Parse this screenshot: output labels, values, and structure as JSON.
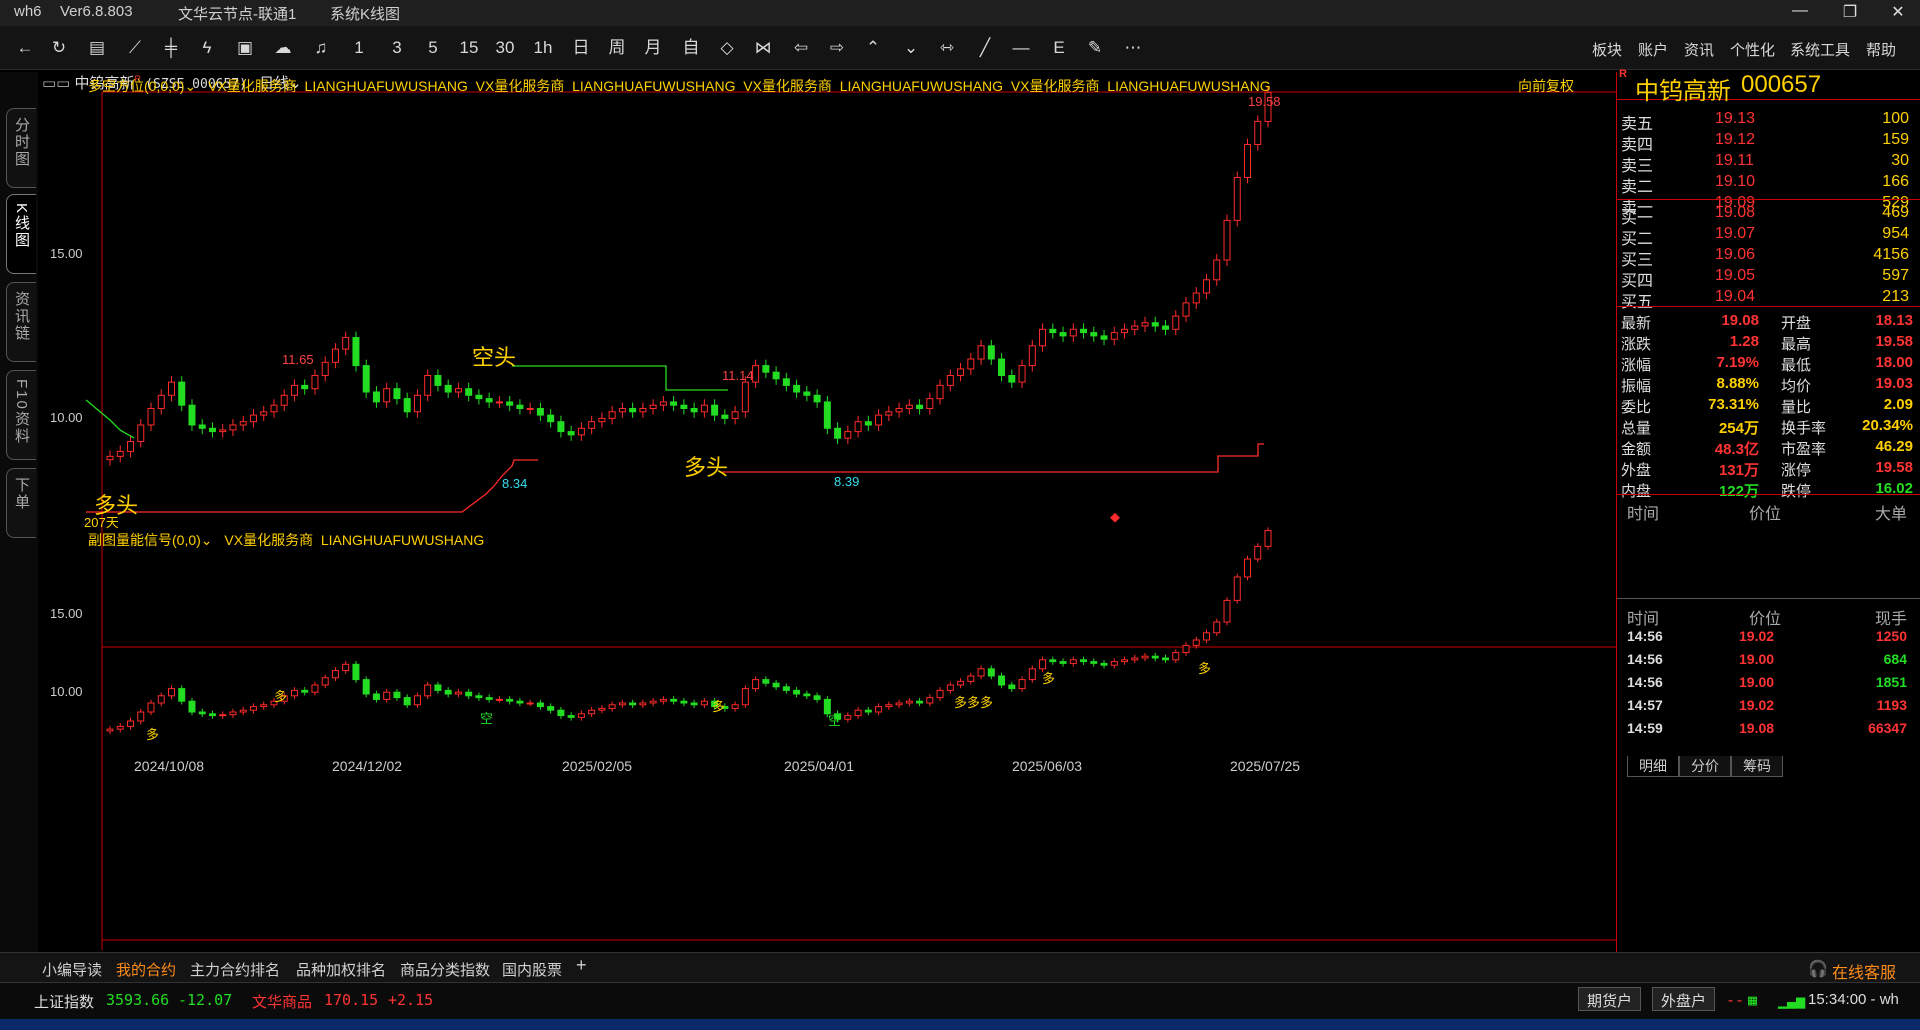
{
  "titlebar": {
    "app": "wh6",
    "version": "Ver6.8.803",
    "node": "文华云节点-联通1",
    "window": "系统K线图"
  },
  "toolbar": {
    "periods": [
      "1",
      "3",
      "5",
      "15",
      "30",
      "1h",
      "日",
      "周",
      "月",
      "自"
    ],
    "menu": [
      "板块",
      "账户",
      "资讯",
      "个性化",
      "系统工具",
      "帮助"
    ]
  },
  "left_tabs": [
    "分时图",
    "K线图",
    "资讯链",
    "F10资料",
    "下单"
  ],
  "header": {
    "stock_name": "中钨高新",
    "stock_sup": "R",
    "code_full": "(SZSE 000657)",
    "period": "日线"
  },
  "main_indicator": {
    "name": "多空方位(0,0,0)",
    "text": "VX量化服务商  LIANGHUAFUWUSHANG  VX量化服务商  LIANGHUAFUWUSHANG  VX量化服务商  LIANGHUAFUWUSHANG  VX量化服务商  LIANGHUAFUWUSHANG",
    "adjust": "向前复权"
  },
  "sub_indicator": {
    "name": "副图量能信号(0,0)",
    "text": "VX量化服务商  LIANGHUAFUWUSHANG"
  },
  "annotations": {
    "kongtou": "空头",
    "duotou1": "多头",
    "duotou2": "多头",
    "days": "207天",
    "high1": "11.65",
    "high2": "11.14",
    "low1": "8.34",
    "low2": "8.39",
    "top": "19.58",
    "sig_duo": "多",
    "sig_kong": "空",
    "sig_duo3": "多多多"
  },
  "chart_data": {
    "type": "candlestick",
    "y_ticks_main": [
      "15.00",
      "10.00"
    ],
    "y_ticks_sub": [
      "15.00",
      "10.00"
    ],
    "x_ticks": [
      "2024/10/08",
      "2024/12/02",
      "2025/02/05",
      "2025/04/01",
      "2025/06/03",
      "2025/07/25"
    ],
    "close": [
      8.05,
      8.2,
      8.5,
      9.0,
      9.5,
      9.9,
      10.3,
      9.6,
      9.0,
      8.9,
      8.8,
      8.85,
      9.0,
      9.1,
      9.3,
      9.4,
      9.6,
      9.9,
      10.2,
      10.1,
      10.5,
      10.9,
      11.3,
      11.65,
      10.8,
      10.0,
      9.7,
      10.1,
      9.8,
      9.4,
      9.9,
      10.5,
      10.2,
      10.0,
      10.1,
      9.9,
      9.8,
      9.7,
      9.7,
      9.6,
      9.5,
      9.5,
      9.3,
      9.1,
      8.8,
      8.7,
      8.9,
      9.1,
      9.2,
      9.4,
      9.5,
      9.4,
      9.5,
      9.6,
      9.7,
      9.6,
      9.5,
      9.4,
      9.6,
      9.3,
      9.2,
      9.4,
      10.3,
      10.8,
      10.6,
      10.4,
      10.2,
      10.0,
      9.9,
      9.7,
      8.9,
      8.6,
      8.8,
      9.1,
      9.0,
      9.3,
      9.4,
      9.5,
      9.6,
      9.5,
      9.8,
      10.2,
      10.5,
      10.7,
      11.0,
      11.4,
      11.0,
      10.5,
      10.3,
      10.8,
      11.4,
      11.9,
      11.8,
      11.7,
      11.9,
      11.8,
      11.7,
      11.6,
      11.8,
      11.9,
      12.0,
      12.1,
      12.0,
      11.9,
      12.3,
      12.7,
      13.0,
      13.4,
      14.0,
      15.2,
      16.5,
      17.5,
      18.2,
      19.08
    ],
    "series_names": [
      "K线"
    ]
  },
  "quote": {
    "stock_title": "中钨高新",
    "stock_code": "000657",
    "asks": [
      {
        "label": "卖五",
        "price": "19.13",
        "vol": "100"
      },
      {
        "label": "卖四",
        "price": "19.12",
        "vol": "159"
      },
      {
        "label": "卖三",
        "price": "19.11",
        "vol": "30"
      },
      {
        "label": "卖二",
        "price": "19.10",
        "vol": "166"
      },
      {
        "label": "卖一",
        "price": "19.09",
        "vol": "529"
      }
    ],
    "bids": [
      {
        "label": "买一",
        "price": "19.08",
        "vol": "469"
      },
      {
        "label": "买二",
        "price": "19.07",
        "vol": "954"
      },
      {
        "label": "买三",
        "price": "19.06",
        "vol": "4156"
      },
      {
        "label": "买四",
        "price": "19.05",
        "vol": "597"
      },
      {
        "label": "买五",
        "price": "19.04",
        "vol": "213"
      }
    ],
    "stats": [
      {
        "k1": "最新",
        "v1": "19.08",
        "c1": "#ff3333",
        "k2": "开盘",
        "v2": "18.13",
        "c2": "#ff3333"
      },
      {
        "k1": "涨跌",
        "v1": "1.28",
        "c1": "#ff3333",
        "k2": "最高",
        "v2": "19.58",
        "c2": "#ff3333"
      },
      {
        "k1": "涨幅",
        "v1": "7.19%",
        "c1": "#ff3333",
        "k2": "最低",
        "v2": "18.00",
        "c2": "#ff3333"
      },
      {
        "k1": "振幅",
        "v1": "8.88%",
        "c1": "#ffd000",
        "k2": "均价",
        "v2": "19.03",
        "c2": "#ff3333"
      },
      {
        "k1": "委比",
        "v1": "73.31%",
        "c1": "#ffd000",
        "k2": "量比",
        "v2": "2.09",
        "c2": "#ffd000"
      },
      {
        "k1": "总量",
        "v1": "254万",
        "c1": "#ffd000",
        "k2": "换手率",
        "v2": "20.34%",
        "c2": "#ffd000"
      },
      {
        "k1": "金额",
        "v1": "48.3亿",
        "c1": "#ff3333",
        "k2": "市盈率",
        "v2": "46.29",
        "c2": "#ffd000"
      },
      {
        "k1": "外盘",
        "v1": "131万",
        "c1": "#ff3333",
        "k2": "涨停",
        "v2": "19.58",
        "c2": "#ff3333"
      },
      {
        "k1": "内盘",
        "v1": "122万",
        "c1": "#22dd22",
        "k2": "跌停",
        "v2": "16.02",
        "c2": "#22dd22"
      }
    ],
    "big_header": {
      "t": "时间",
      "p": "价位",
      "v": "大单"
    },
    "ticks_header": {
      "t": "时间",
      "p": "价位",
      "v": "现手"
    },
    "ticks": [
      {
        "t": "14:56",
        "p": "19.02",
        "v": "1250",
        "vc": "#ff3333"
      },
      {
        "t": "14:56",
        "p": "19.00",
        "v": "684",
        "vc": "#22dd22"
      },
      {
        "t": "14:56",
        "p": "19.00",
        "v": "1851",
        "vc": "#22dd22"
      },
      {
        "t": "14:57",
        "p": "19.02",
        "v": "1193",
        "vc": "#ff3333"
      },
      {
        "t": "14:59",
        "p": "19.08",
        "v": "66347",
        "vc": "#ff3333"
      }
    ],
    "tabs": [
      "明细",
      "分价",
      "筹码"
    ]
  },
  "bottom_tabs": [
    "小编导读",
    "我的合约",
    "主力合约排名",
    "品种加权排名",
    "商品分类指数",
    "国内股票"
  ],
  "service": "在线客服",
  "status": {
    "idx1_name": "上证指数",
    "idx1_val": "3593.66",
    "idx1_chg": "-12.07",
    "idx2_name": "文华商品",
    "idx2_val": "170.15",
    "idx2_chg": "+2.15",
    "btn1": "期货户",
    "btn2": "外盘户",
    "time": "15:34:00 - wh"
  }
}
